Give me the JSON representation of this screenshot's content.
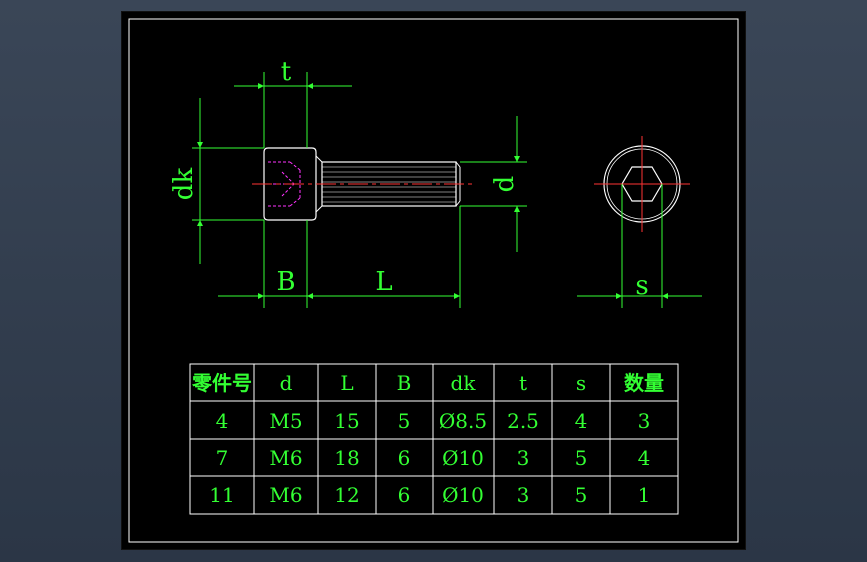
{
  "dimension_labels": {
    "t": "t",
    "dk": "dk",
    "d": "d",
    "B": "B",
    "L": "L",
    "s": "s"
  },
  "table": {
    "headers": [
      "零件号",
      "d",
      "L",
      "B",
      "dk",
      "t",
      "s",
      "数量"
    ],
    "rows": [
      [
        "4",
        "M5",
        "15",
        "5",
        "Ø8.5",
        "2.5",
        "4",
        "3"
      ],
      [
        "7",
        "M6",
        "18",
        "6",
        "Ø10",
        "3",
        "5",
        "4"
      ],
      [
        "11",
        "M6",
        "12",
        "6",
        "Ø10",
        "3",
        "5",
        "1"
      ]
    ]
  },
  "colors": {
    "background": "#2f3b4b",
    "sheet": "#000000",
    "dimension": "#33ff33",
    "outline": "#ffffff",
    "centerline": "#ff3333",
    "hidden": "#ff33ff"
  }
}
